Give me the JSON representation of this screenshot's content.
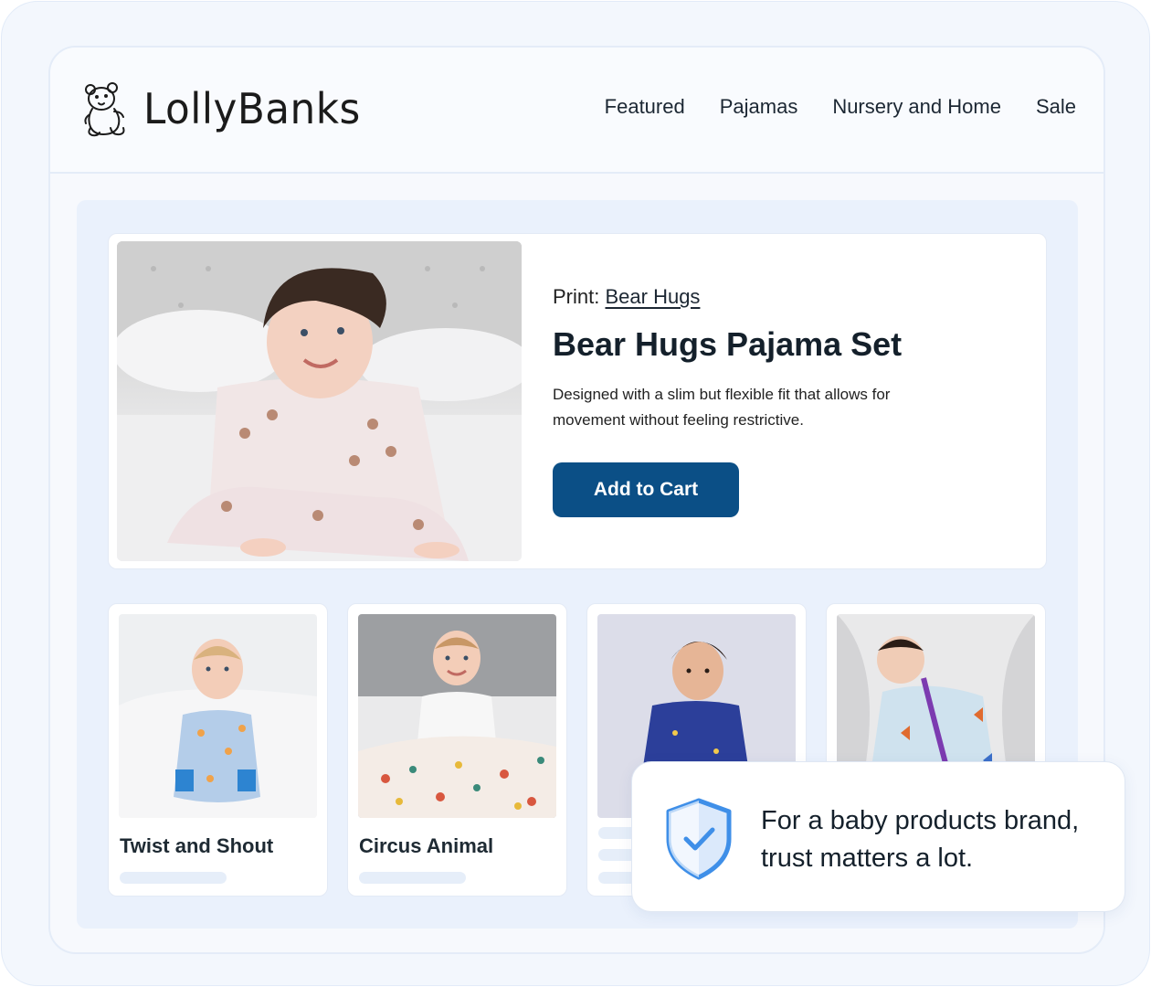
{
  "brand": {
    "name": "LollyBanks"
  },
  "nav": {
    "items": [
      "Featured",
      "Pajamas",
      "Nursery and Home",
      "Sale"
    ]
  },
  "hero": {
    "print_label": "Print:",
    "print_name": "Bear Hugs",
    "title": "Bear Hugs Pajama Set",
    "description": "Designed with a slim but flexible fit that allows for movement without feeling restrictive.",
    "cta": "Add to Cart"
  },
  "products": [
    {
      "title": "Twist and Shout"
    },
    {
      "title": "Circus Animal"
    },
    {
      "title": ""
    },
    {
      "title": ""
    }
  ],
  "callout": {
    "text": "For a baby products brand, trust matters a lot."
  },
  "colors": {
    "accent": "#0b4f86",
    "shield": "#3f8fe8",
    "background": "#f3f7fd"
  }
}
